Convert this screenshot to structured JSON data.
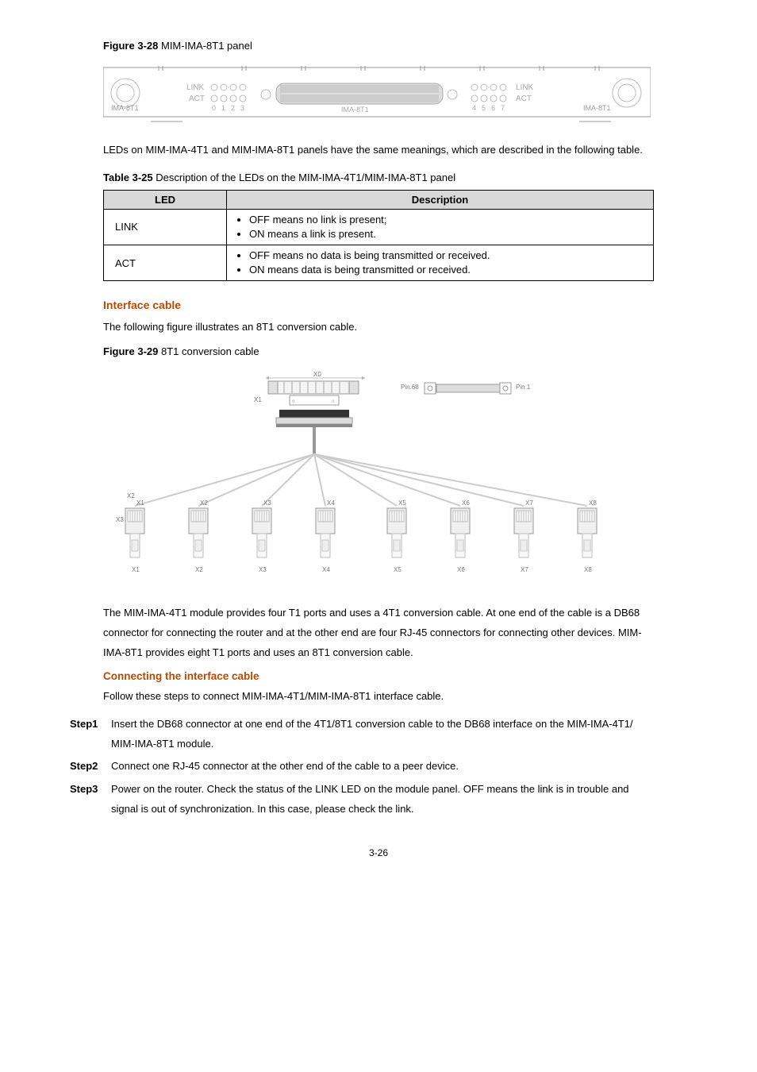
{
  "figure28": {
    "label": "Figure 3-28",
    "title": "MIM-IMA-8T1 panel"
  },
  "panel": {
    "led_link": "LINK",
    "led_act": "ACT",
    "model_left": "IMA-8T1",
    "center_label": "IMA-8T1",
    "model_right": "IMA-8T1",
    "ports_left": [
      "0",
      "1",
      "2",
      "3"
    ],
    "ports_right": [
      "4",
      "5",
      "6",
      "7"
    ]
  },
  "paragraph1": "LEDs on MIM-IMA-4T1 and MIM-IMA-8T1 panels have the same meanings, which are described in the following table.",
  "table25": {
    "label": "Table 3-25",
    "title": "Description of the LEDs on the MIM-IMA-4T1/MIM-IMA-8T1 panel",
    "headers": {
      "led": "LED",
      "description": "Description"
    },
    "rows": [
      {
        "name": "LINK",
        "bullets": [
          "OFF means no link is present;",
          "ON means a link is present."
        ]
      },
      {
        "name": "ACT",
        "bullets": [
          "OFF means no data is being transmitted or received.",
          "ON means data is being transmitted or received."
        ]
      }
    ]
  },
  "sections": {
    "interface_cable": "Interface cable",
    "interface_cable_text": "The following figure illustrates an 8T1 conversion cable.",
    "figure29": {
      "label": "Figure 3-29",
      "title": "8T1 conversion cable"
    },
    "cable": {
      "x0": "X0",
      "x1": "X1",
      "x2": "X2",
      "x3": "X3",
      "pin_left": "Pin.68",
      "pin_right": "Pin.1",
      "branches": [
        "X1",
        "X2",
        "X3",
        "X4",
        "X5",
        "X6",
        "X7",
        "X8"
      ],
      "branches_bottom": [
        "X1",
        "X2",
        "X3",
        "X4",
        "X5",
        "X6",
        "X7",
        "X8"
      ]
    },
    "paragraph2": "The MIM-IMA-4T1 module provides four T1 ports and uses a 4T1 conversion cable. At one end of the cable is a DB68 connector for connecting the router and at the other end are four RJ-45 connectors for connecting other devices. MIM-IMA-8T1 provides eight T1 ports and uses an 8T1 conversion cable.",
    "connecting": "Connecting the interface cable",
    "connecting_intro": "Follow these steps to connect MIM-IMA-4T1/MIM-IMA-8T1 interface cable.",
    "steps": [
      {
        "label": "Step1",
        "text": "Insert the DB68 connector at one end of the 4T1/8T1 conversion cable to the DB68 interface on the MIM-IMA-4T1/ MIM-IMA-8T1 module."
      },
      {
        "label": "Step2",
        "text": "Connect one RJ-45 connector at the other end of the cable to a peer device."
      },
      {
        "label": "Step3",
        "text": "Power on the router. Check the status of the LINK LED on the module panel. OFF means the link is in trouble and signal is out of synchronization. In this case, please check the link."
      }
    ]
  },
  "page_number": "3-26"
}
